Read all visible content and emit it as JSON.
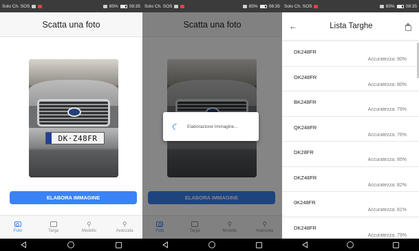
{
  "statusbar": {
    "carrier": "Solo Ch. SOS",
    "battery": "85%",
    "time": "08:35"
  },
  "screen1": {
    "title": "Scatta una foto",
    "plate_text": "DK·Z48FR",
    "button_label": "ELABORA IMMAGINE",
    "tabs": [
      {
        "label": "Foto",
        "icon": "camera-icon",
        "active": true
      },
      {
        "label": "Targa",
        "icon": "card-icon",
        "active": false
      },
      {
        "label": "Modello",
        "icon": "search-icon",
        "active": false
      },
      {
        "label": "Avanzata",
        "icon": "search-icon",
        "active": false
      }
    ]
  },
  "screen2": {
    "title": "Scatta una foto",
    "button_label": "ELABORA IMMAGINE",
    "dialog_text": "Elaborazione Immagine...",
    "tabs": [
      {
        "label": "Foto"
      },
      {
        "label": "Targa"
      },
      {
        "label": "Modello"
      },
      {
        "label": "Avanzata"
      }
    ]
  },
  "screen3": {
    "title": "Lista Targhe",
    "back_icon": "arrow-left-icon",
    "home_icon": "home-icon",
    "items": [
      {
        "plate": "DK248FR",
        "accuracy": "Accuratezza: 90%"
      },
      {
        "plate": "OK248FR",
        "accuracy": "Accuratezza: 80%"
      },
      {
        "plate": "BK248FR",
        "accuracy": "Accuratezza: 79%"
      },
      {
        "plate": "QK248FR",
        "accuracy": "Accuratezza: 76%"
      },
      {
        "plate": "DK28FR",
        "accuracy": "Accuratezza: 85%"
      },
      {
        "plate": "DKZ48FR",
        "accuracy": "Accuratezza: 82%"
      },
      {
        "plate": "0K248FR",
        "accuracy": "Accuratezza: 81%"
      },
      {
        "plate": "DK248FR",
        "accuracy": "Accuratezza: 79%"
      }
    ]
  },
  "colors": {
    "accent": "#3b82f6",
    "statusbar": "#3b3b3b",
    "navbar": "#000000"
  }
}
